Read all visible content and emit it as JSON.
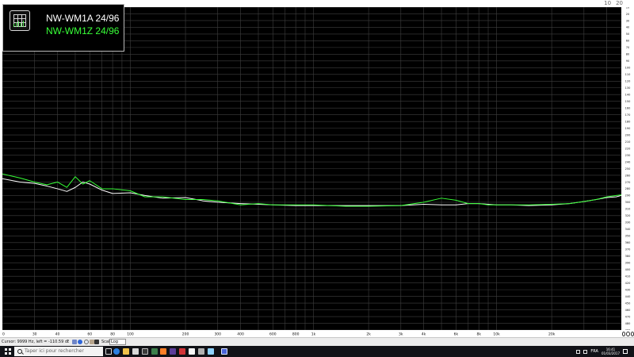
{
  "colors": {
    "plot_background": "#000000",
    "grid": "#3f3f3f",
    "series_1": "#ffffff",
    "series_2": "#36ff36"
  },
  "top_right": {
    "mini_a": "10",
    "mini_b": "20"
  },
  "legend": {
    "series_1": "NW-WM1A 24/96",
    "series_2": "NW-WM1Z 24/96"
  },
  "y_axis": {
    "ticks": [
      "10",
      "20",
      "30",
      "40",
      "50",
      "60",
      "70",
      "80",
      "90",
      "100",
      "110",
      "120",
      "130",
      "140",
      "150",
      "160",
      "170",
      "180",
      "190",
      "200",
      "210",
      "220",
      "230",
      "240",
      "250",
      "260",
      "270",
      "280",
      "290",
      "300",
      "310",
      "320",
      "330",
      "340",
      "350",
      "360",
      "370",
      "380",
      "390",
      "400",
      "410",
      "420",
      "430",
      "440",
      "450",
      "460",
      "470",
      "480",
      "490"
    ]
  },
  "x_axis": {
    "ticks": [
      "20",
      "30",
      "40",
      "60",
      "80",
      "100",
      "200",
      "300",
      "400",
      "600",
      "800",
      "1k",
      "2k",
      "3k",
      "4k",
      "6k",
      "8k",
      "10k",
      "20k"
    ]
  },
  "status_bar": {
    "info": "Cursor: 9999 Hz, left = -110.59 dB, right = -111.27 dB",
    "scale_label": "Scale:",
    "scale_value": "Log"
  },
  "taskbar": {
    "search_placeholder": "Taper ici pour rechercher",
    "tray_language": "FRA",
    "clock_time": "16:41",
    "clock_date": "01/03/2017"
  },
  "chart_data": {
    "type": "line",
    "x_scale": "log",
    "grid": true,
    "legend_position": "top-left",
    "xlim": [
      20,
      48000
    ],
    "ylim": [
      490,
      10
    ],
    "series": [
      {
        "name": "NW-WM1A 24/96",
        "color": "#ffffff",
        "x": [
          20,
          25,
          30,
          35,
          40,
          45,
          50,
          55,
          60,
          70,
          80,
          100,
          120,
          150,
          200,
          250,
          300,
          400,
          500,
          600,
          800,
          1000,
          1500,
          2000,
          3000,
          4000,
          5000,
          6000,
          7000,
          8000,
          9000,
          10000,
          12000,
          15000,
          20000,
          25000,
          30000,
          35000,
          40000,
          45000,
          48000
        ],
        "y": [
          265,
          270,
          272,
          276,
          280,
          284,
          278,
          270,
          273,
          282,
          287,
          286,
          290,
          294,
          293,
          298,
          300,
          302,
          303,
          304,
          305,
          305,
          305,
          305,
          305,
          303,
          304,
          304,
          302,
          302,
          303,
          304,
          304,
          305,
          304,
          302,
          299,
          296,
          293,
          292,
          290
        ]
      },
      {
        "name": "NW-WM1Z 24/96",
        "color": "#36ff36",
        "x": [
          20,
          25,
          30,
          35,
          40,
          45,
          50,
          55,
          60,
          70,
          80,
          100,
          120,
          150,
          200,
          250,
          300,
          400,
          500,
          600,
          800,
          1000,
          1500,
          2000,
          3000,
          4000,
          5000,
          6000,
          7000,
          8000,
          9000,
          10000,
          12000,
          15000,
          20000,
          25000,
          30000,
          35000,
          40000,
          45000,
          48000
        ],
        "y": [
          258,
          264,
          270,
          274,
          270,
          278,
          262,
          273,
          268,
          280,
          280,
          283,
          292,
          292,
          296,
          296,
          298,
          304,
          302,
          304,
          304,
          304,
          306,
          306,
          305,
          300,
          294,
          297,
          302,
          302,
          304,
          304,
          304,
          304,
          303,
          302,
          299,
          296,
          292,
          290,
          289
        ]
      }
    ]
  }
}
